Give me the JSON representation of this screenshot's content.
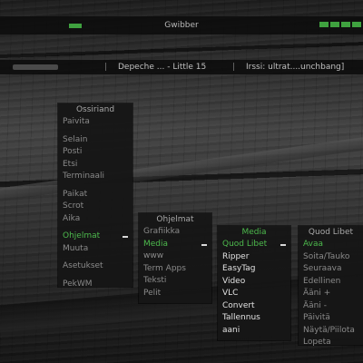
{
  "topbar": {
    "title": "Gwibber"
  },
  "taskbar": {
    "tasks": [
      "Depeche ... - Little 15",
      "Irssi: ultrat....unchbang]"
    ]
  },
  "menus": {
    "main": {
      "title": "Ossiriand",
      "items": [
        "Paivita",
        "Selain",
        "Posti",
        "Etsi",
        "Terminaali",
        "Paikat",
        "Scrot",
        "Aika",
        "Ohjelmat",
        "Muuta",
        "Asetukset",
        "PekWM"
      ]
    },
    "programs": {
      "title": "Ohjelmat",
      "items": [
        "Grafiikka",
        "Media",
        "www",
        "Term Apps",
        "Teksti",
        "Pelit"
      ]
    },
    "media": {
      "title": "Media",
      "items": [
        "Quod Libet",
        "Ripper",
        "EasyTag",
        "Video",
        "VLC",
        "Convert",
        "Tallennus",
        "aani"
      ]
    },
    "quodlibet": {
      "title": "Quod Libet",
      "items": [
        "Avaa",
        "Soita/Tauko",
        "Seuraava",
        "Edellinen",
        "Ääni +",
        "Ääni -",
        "Päivitä",
        "Näytä/Piilota",
        "Lopeta"
      ]
    }
  },
  "colors": {
    "accent": "#4dba4d",
    "panel": "#161616"
  }
}
